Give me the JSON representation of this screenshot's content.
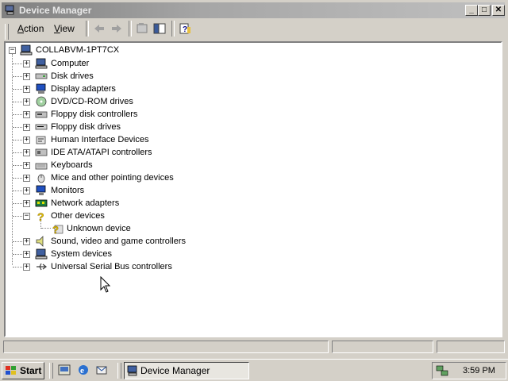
{
  "window": {
    "title": "Device Manager",
    "controls": {
      "minimize": "_",
      "maximize": "□",
      "close": "✕"
    }
  },
  "menu": {
    "action": "Action",
    "view": "View"
  },
  "toolbar": {
    "icons": [
      "back-arrow-icon",
      "forward-arrow-icon",
      "properties-icon",
      "show-hide-tree-icon",
      "help-icon"
    ]
  },
  "tree": {
    "root": "COLLABVM-1PT7CX",
    "items": [
      {
        "label": "Computer",
        "icon": "computer-icon",
        "expanded": false
      },
      {
        "label": "Disk drives",
        "icon": "disk-drive-icon",
        "expanded": false
      },
      {
        "label": "Display adapters",
        "icon": "display-adapter-icon",
        "expanded": false
      },
      {
        "label": "DVD/CD-ROM drives",
        "icon": "cdrom-icon",
        "expanded": false
      },
      {
        "label": "Floppy disk controllers",
        "icon": "floppy-controller-icon",
        "expanded": false
      },
      {
        "label": "Floppy disk drives",
        "icon": "floppy-drive-icon",
        "expanded": false
      },
      {
        "label": "Human Interface Devices",
        "icon": "hid-icon",
        "expanded": false
      },
      {
        "label": "IDE ATA/ATAPI controllers",
        "icon": "ide-controller-icon",
        "expanded": false
      },
      {
        "label": "Keyboards",
        "icon": "keyboard-icon",
        "expanded": false
      },
      {
        "label": "Mice and other pointing devices",
        "icon": "mouse-icon",
        "expanded": false
      },
      {
        "label": "Monitors",
        "icon": "monitor-icon",
        "expanded": false
      },
      {
        "label": "Network adapters",
        "icon": "network-adapter-icon",
        "expanded": false
      },
      {
        "label": "Other devices",
        "icon": "question-icon",
        "expanded": true
      },
      {
        "label": "Unknown device",
        "icon": "unknown-device-icon",
        "child": true
      },
      {
        "label": "Sound, video and game controllers",
        "icon": "speaker-icon",
        "expanded": false
      },
      {
        "label": "System devices",
        "icon": "system-device-icon",
        "expanded": false
      },
      {
        "label": "Universal Serial Bus controllers",
        "icon": "usb-icon",
        "expanded": false
      }
    ]
  },
  "taskbar": {
    "start": "Start",
    "task": "Device Manager",
    "clock": "3:59 PM"
  },
  "colors": {
    "titlebar_inactive": "#808080",
    "face": "#d4d0c8",
    "tree_bg": "#ffffff"
  }
}
